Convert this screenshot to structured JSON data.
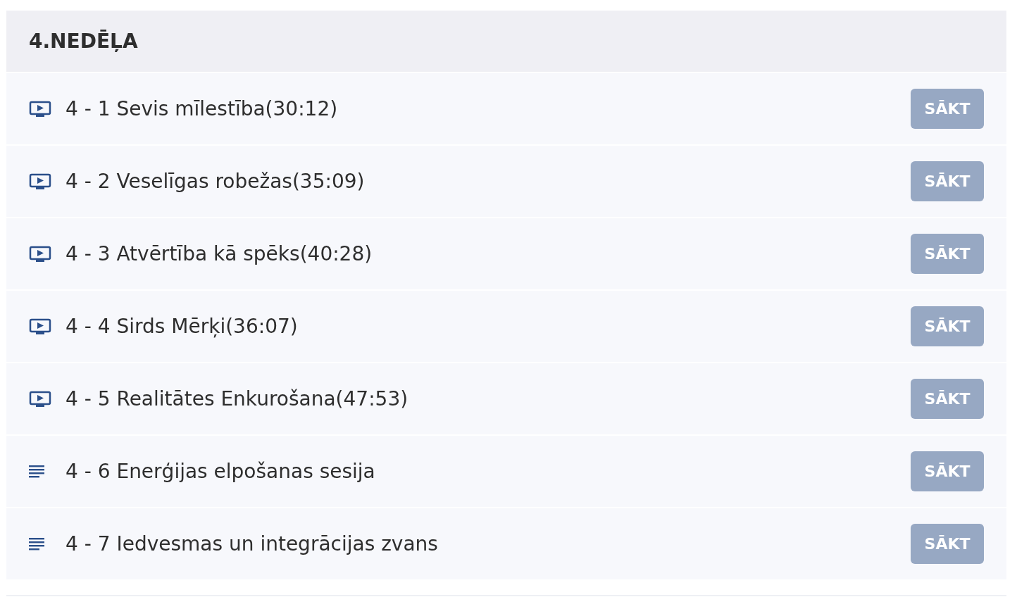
{
  "section": {
    "title": "4.NEDĒĻA"
  },
  "lessons": [
    {
      "kind": "video",
      "title": "4 - 1 Sevis mīlestība(30:12)",
      "button": "SĀKT"
    },
    {
      "kind": "video",
      "title": "4 - 2 Veselīgas robežas(35:09)",
      "button": "SĀKT"
    },
    {
      "kind": "video",
      "title": "4 - 3 Atvērtība kā spēks(40:28)",
      "button": "SĀKT"
    },
    {
      "kind": "video",
      "title": "4 - 4 Sirds Mērķi(36:07)",
      "button": "SĀKT"
    },
    {
      "kind": "video",
      "title": "4 - 5 Realitātes Enkurošana(47:53)",
      "button": "SĀKT"
    },
    {
      "kind": "text",
      "title": "4 - 6 Enerģijas elpošanas sesija",
      "button": "SĀKT"
    },
    {
      "kind": "text",
      "title": "4 - 7 Iedvesmas un integrācijas zvans",
      "button": "SĀKT"
    }
  ]
}
